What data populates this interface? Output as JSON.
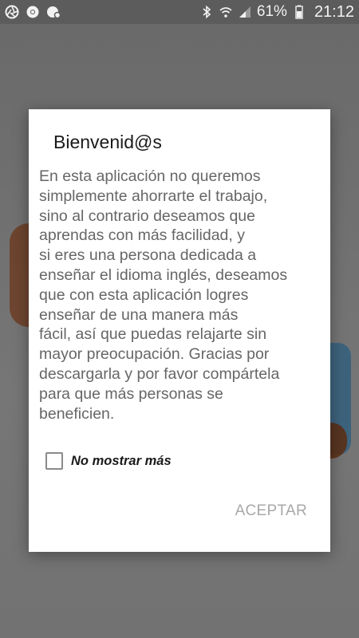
{
  "status_bar": {
    "left_icons": [
      "camera-shutter-icon",
      "chrome-icon",
      "photo-notification-icon"
    ],
    "battery_percent": "61%",
    "time": "21:12"
  },
  "dialog": {
    "title": "Bienvenid@s",
    "message": "En esta aplicación no queremos\nsimplemente ahorrarte el trabajo,\nsino al contrario deseamos que\naprendas con más facilidad, y\nsi eres una persona dedicada a\nenseñar el idioma inglés, deseamos\nque con esta aplicación logres\nenseñar de una manera más\nfácil, así que puedas relajarte sin\nmayor preocupación. Gracias por\ndescargarla y por favor compártela\npara que más personas se\nbeneficien.",
    "checkbox_label": "No mostrar más",
    "checkbox_checked": false,
    "accept_label": "ACEPTAR"
  }
}
